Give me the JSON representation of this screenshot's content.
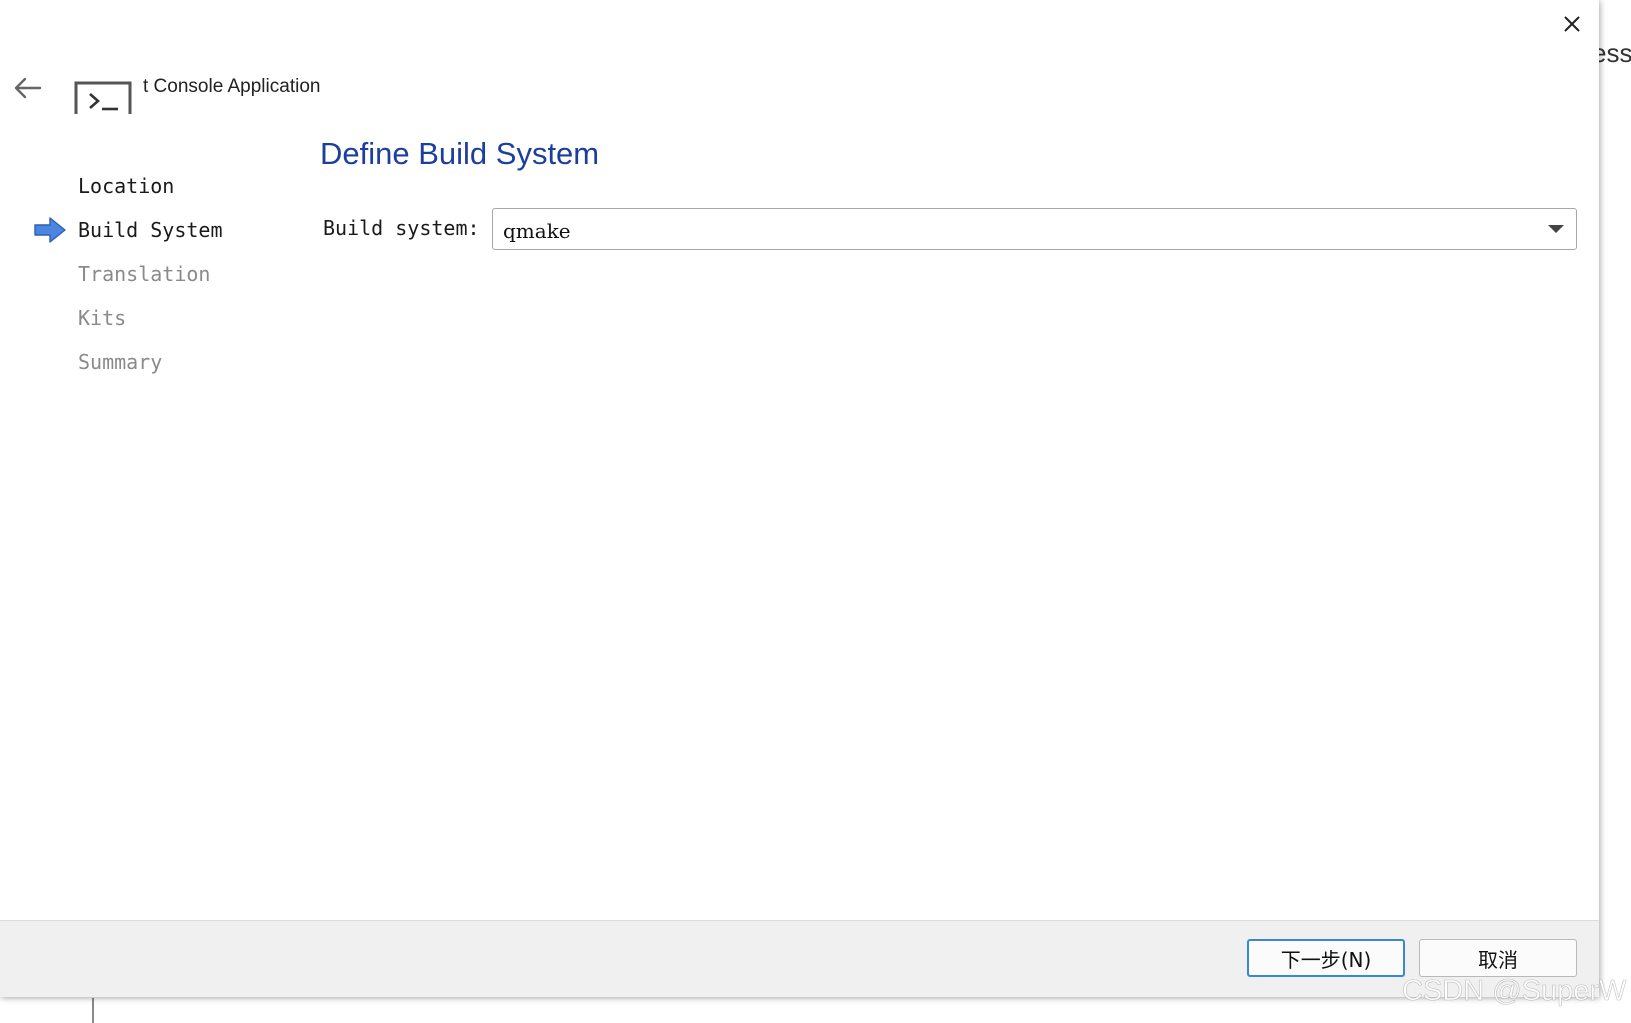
{
  "background_window": {
    "partial_text": "essi"
  },
  "dialog": {
    "title": "t Console Application",
    "icons": {
      "back": "arrow-left-icon",
      "app": "terminal-icon",
      "close": "close-icon",
      "step_marker": "arrow-right-icon"
    }
  },
  "steps": [
    {
      "label": "Location",
      "state": "done"
    },
    {
      "label": "Build System",
      "state": "current"
    },
    {
      "label": "Translation",
      "state": "pending"
    },
    {
      "label": "Kits",
      "state": "pending"
    },
    {
      "label": "Summary",
      "state": "pending"
    }
  ],
  "page": {
    "title": "Define Build System",
    "build_system_label": "Build system:",
    "build_system_value": "qmake"
  },
  "buttons": {
    "next": "下一步(N)",
    "cancel": "取消"
  },
  "watermark": "CSDN @SuperW",
  "colors": {
    "title_blue": "#1c3e9e",
    "step_arrow_blue": "#4a86e0",
    "focus_border": "#3c86d8"
  }
}
